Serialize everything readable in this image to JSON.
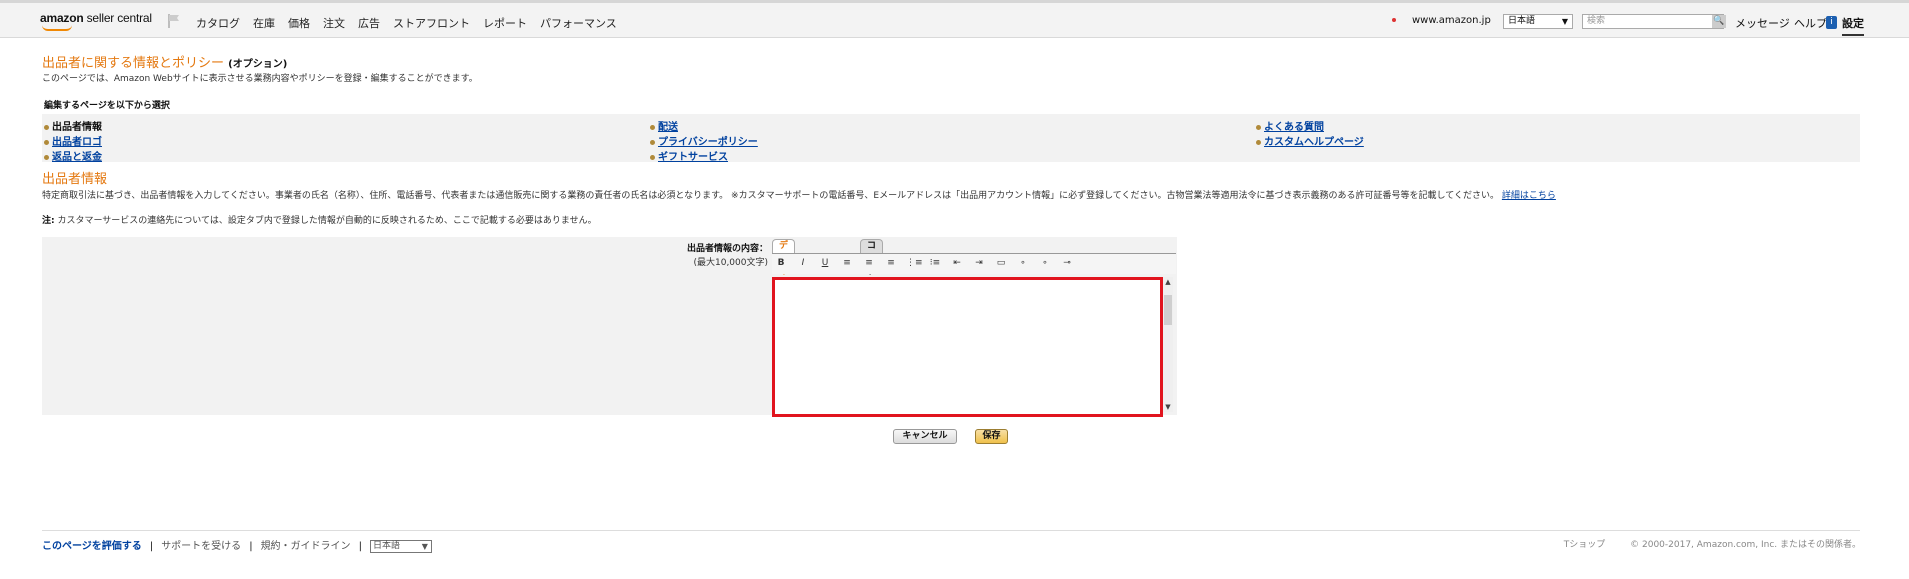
{
  "topbar": {
    "logo_main": "amazon",
    "logo_sub": "seller central",
    "nav": [
      "カタログ",
      "在庫",
      "価格",
      "注文",
      "広告",
      "ストアフロント",
      "レポート",
      "パフォーマンス"
    ],
    "marketplace": "www.amazon.jp",
    "language": "日本語",
    "search_placeholder": "検索",
    "search_button": "🔍",
    "messages": "メッセージ",
    "help": "ヘルプ",
    "settings": "設定"
  },
  "page": {
    "title": "出品者に関する情報とポリシー",
    "title_suffix": "(オプション)",
    "description": "このページでは、Amazon Webサイトに表示させる業務内容やポリシーを登録・編集することができます。"
  },
  "selector": {
    "heading": "編集するページを以下から選択",
    "col1": [
      "出品者情報",
      "出品者ロゴ",
      "返品と返金"
    ],
    "col2": [
      "配送",
      "プライバシーポリシー",
      "ギフトサービス"
    ],
    "col3": [
      "よくある質問",
      "カスタムヘルプページ"
    ]
  },
  "section": {
    "title": "出品者情報",
    "description": "特定商取引法に基づき、出品者情報を入力してください。事業者の氏名（名称）、住所、電話番号、代表者または通信販売に関する業務の責任者の氏名は必須となります。 ※カスタマーサポートの電話番号、Eメールアドレスは「出品用アカウント情報」に必ず登録してください。古物営業法等適用法令に基づき表示義務のある許可証番号等を記載してください。",
    "details_link": "詳細はこちら",
    "note_label": "注:",
    "note_text": "カスタマーサービスの連絡先については、設定タブ内で登録した情報が自動的に反映されるため、ここで記載する必要はありません。"
  },
  "editor": {
    "label": "出品者情報の内容：",
    "sublabel": "(最大10,000文字)",
    "tab_design": "デザインビュー",
    "tab_code": "コードビュー",
    "toolbar": [
      "B",
      "I",
      "U",
      "≡",
      "≡",
      "≡",
      "⋮≡",
      "⁝≡",
      "⇤",
      "⇥",
      "▭",
      "∘",
      "∘",
      "⊸"
    ],
    "content": ""
  },
  "buttons": {
    "cancel": "キャンセル",
    "save": "保存"
  },
  "footer": {
    "rate": "このページを評価する",
    "support": "サポートを受ける",
    "policies": "規約・ガイドライン",
    "language": "日本語",
    "shop": "Tショップ",
    "copyright": "© 2000-2017, Amazon.com, Inc. またはその関係者。"
  }
}
